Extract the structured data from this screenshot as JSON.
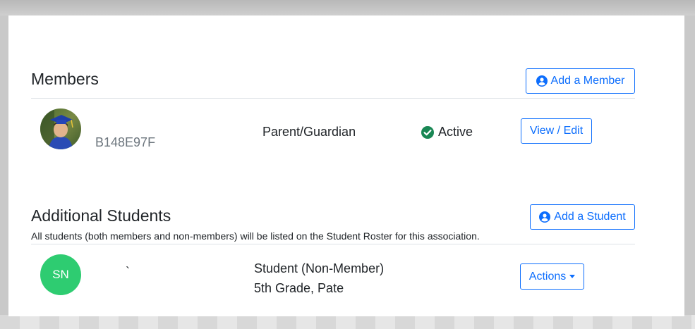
{
  "members": {
    "title": "Members",
    "add_button": "Add a Member",
    "rows": [
      {
        "member_id": "B148E97F",
        "role": "Parent/Guardian",
        "status": "Active",
        "action": "View / Edit"
      }
    ]
  },
  "additional_students": {
    "title": "Additional Students",
    "note": "All students (both members and non-members) will be listed on the Student Roster for this association.",
    "add_button": "Add a Student",
    "rows": [
      {
        "initials": "SN",
        "name": "`",
        "type": "Student (Non-Member)",
        "grade_school": "5th Grade, Pate",
        "action": "Actions"
      }
    ]
  },
  "colors": {
    "accent": "#0d6efd",
    "success": "#198754",
    "avatar_green": "#2ecc71",
    "highlight": "#ffff00"
  },
  "icons": {
    "add_member": "user-circle-icon",
    "add_student": "user-circle-icon",
    "status": "check-circle-icon",
    "actions": "caret-down-icon"
  }
}
